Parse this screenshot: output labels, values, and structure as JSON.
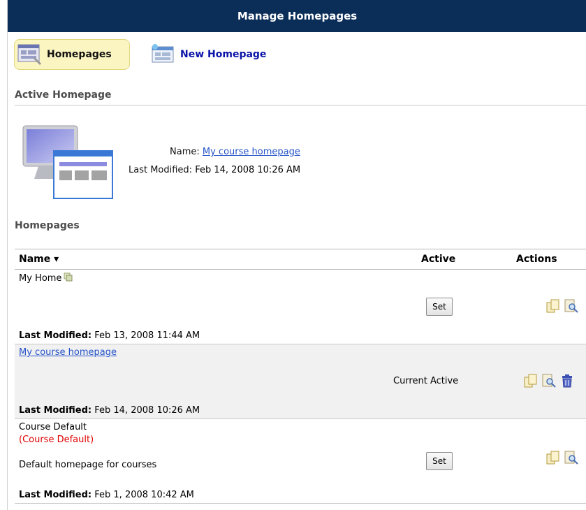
{
  "title": "Manage Homepages",
  "toolbar": {
    "homepages_label": "Homepages",
    "new_homepage_label": "New Homepage"
  },
  "active_section": {
    "title": "Active Homepage",
    "name_label": "Name:",
    "name_value": "My course homepage",
    "modified_label": "Last Modified:",
    "modified_value": "Feb 14, 2008 10:26 AM"
  },
  "homepages_section": {
    "title": "Homepages",
    "columns": {
      "name": "Name ▾",
      "active": "Active",
      "actions": "Actions"
    },
    "rows": [
      {
        "name": "My Home",
        "set_label": "Set",
        "modified_label": "Last Modified:",
        "modified_value": "Feb 13, 2008 11:44 AM"
      },
      {
        "name": "My course homepage",
        "status": "Current Active",
        "modified_label": "Last Modified:",
        "modified_value": "Feb 14, 2008 10:26 AM"
      },
      {
        "name": "Course Default",
        "tag": "(Course Default)",
        "description": "Default homepage for courses",
        "set_label": "Set",
        "modified_label": "Last Modified:",
        "modified_value": "Feb 1, 2008 10:42 AM"
      }
    ]
  },
  "colors": {
    "title_bar": "#0b2e59",
    "active_tab": "#fbf5c2",
    "link": "#2453c8",
    "default_tag": "#e00000"
  },
  "icons": [
    "homepages-icon",
    "new-homepage-icon",
    "monitor-icon",
    "copy-icon",
    "preview-icon",
    "delete-icon",
    "shared-icon"
  ]
}
